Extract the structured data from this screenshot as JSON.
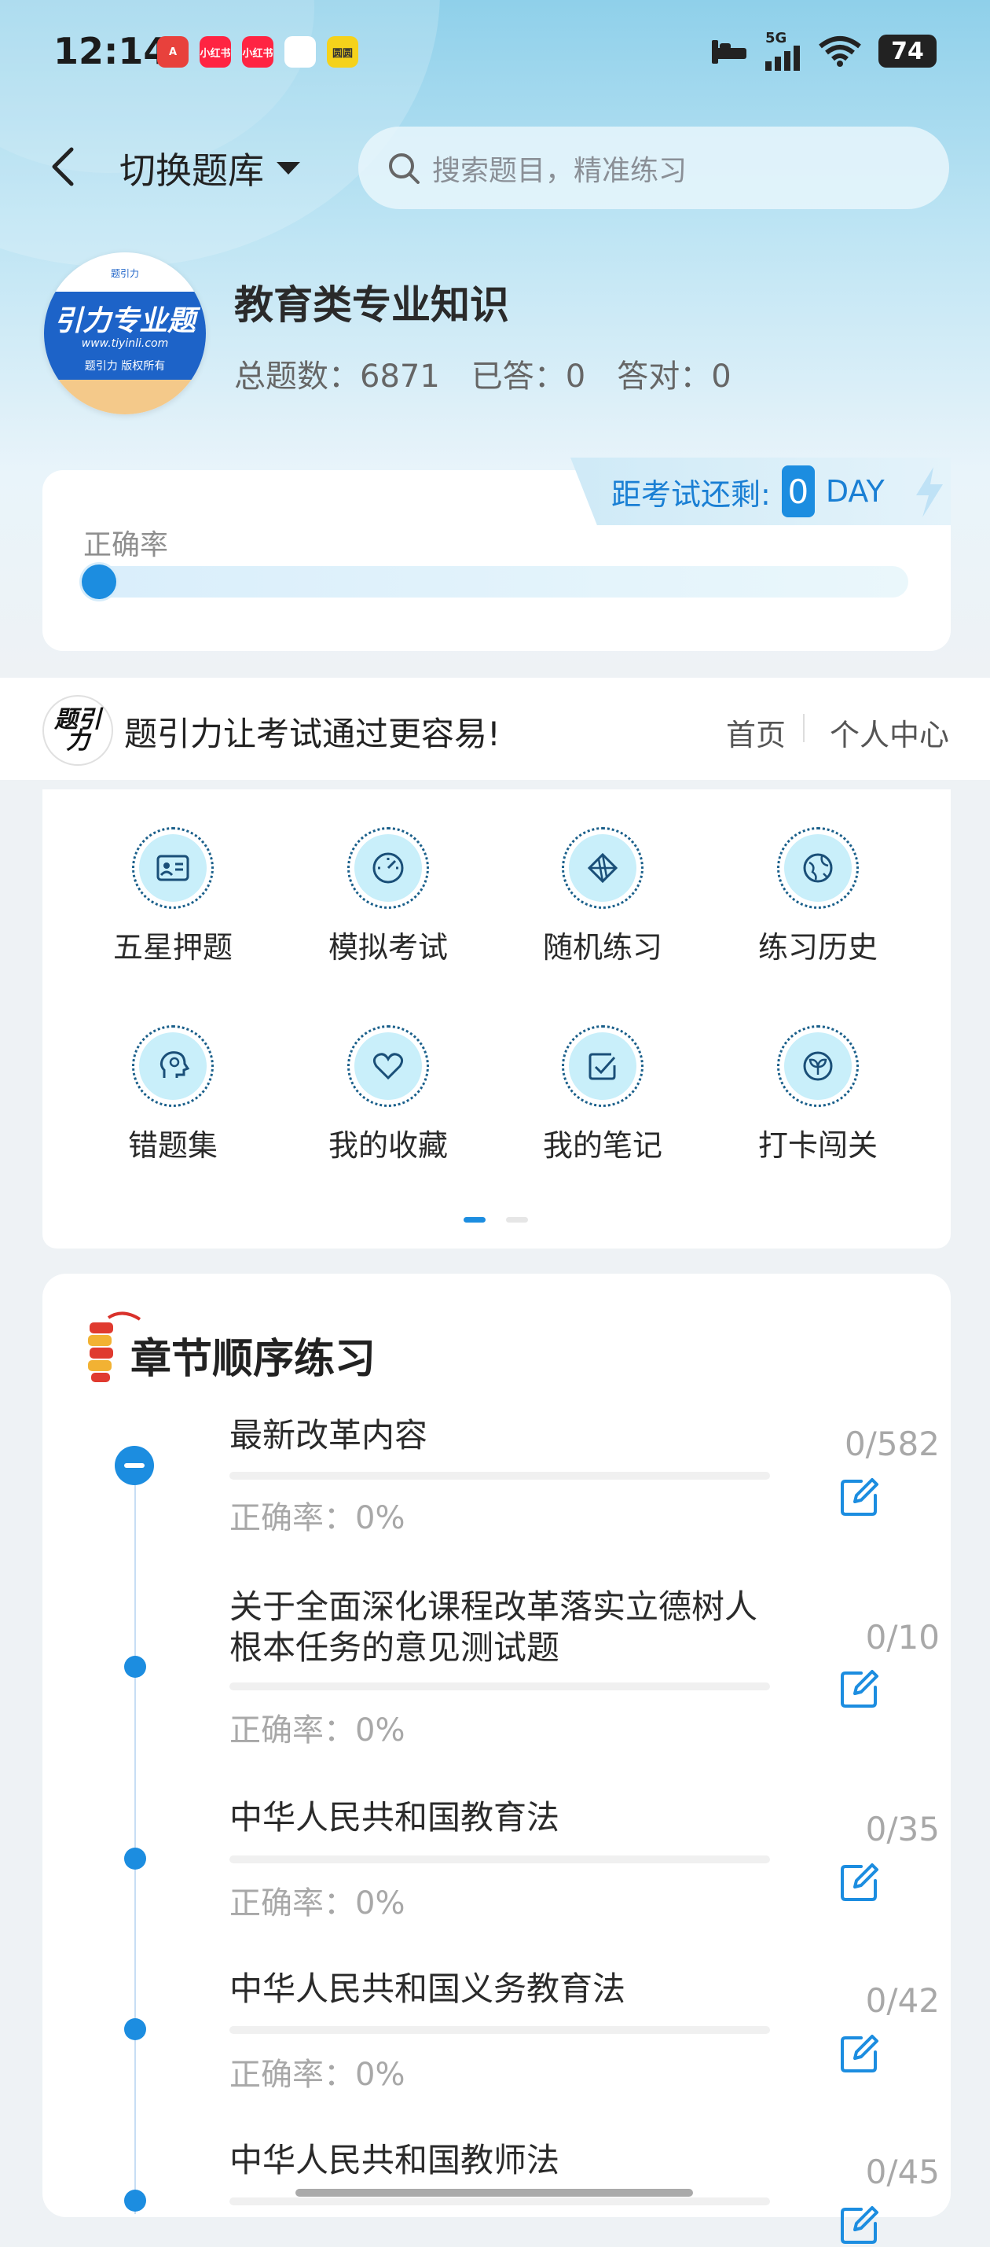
{
  "status_bar": {
    "time": "12:14",
    "app_icons": [
      {
        "name": "app-icon-1",
        "color": "#e8413c",
        "label": "A"
      },
      {
        "name": "xiaohongshu-icon",
        "color": "#ff2442",
        "label": "小红书"
      },
      {
        "name": "xiaohongshu-icon-2",
        "color": "#ff2442",
        "label": "小红书"
      },
      {
        "name": "app-icon-4",
        "color": "#ffffff",
        "label": ""
      },
      {
        "name": "app-icon-5",
        "color": "#f5d21b",
        "label": "圆圆"
      }
    ],
    "network": "5G",
    "battery": "74"
  },
  "header": {
    "switch_label": "切换题库",
    "search_placeholder": "搜索题目，精准练习"
  },
  "bank": {
    "logo_brand": "引力专业题",
    "logo_url": "www.tiyinli.com",
    "logo_rights": "题引力 版权所有",
    "logo_top": "题引力",
    "title": "教育类专业知识",
    "total": "总题数：6871",
    "answered": "已答：0",
    "correct": "答对：0"
  },
  "accuracy_card": {
    "countdown_label": "距考试还剩:",
    "countdown_value": "0",
    "countdown_unit": "DAY",
    "label": "正确率",
    "accuracy_fraction": 0
  },
  "slogan": {
    "logo_text": "题引力",
    "text": "题引力让考试通过更容易!",
    "nav_home": "首页",
    "nav_me": "个人中心"
  },
  "functions": [
    {
      "label": "五星押题",
      "icon": "id-card-icon"
    },
    {
      "label": "模拟考试",
      "icon": "speedometer-icon"
    },
    {
      "label": "随机练习",
      "icon": "shuffle-icon"
    },
    {
      "label": "练习历史",
      "icon": "globe-icon"
    },
    {
      "label": "错题集",
      "icon": "head-icon"
    },
    {
      "label": "我的收藏",
      "icon": "heart-icon"
    },
    {
      "label": "我的笔记",
      "icon": "note-icon"
    },
    {
      "label": "打卡闯关",
      "icon": "sprout-icon"
    }
  ],
  "chapters_section": {
    "title": "章节顺序练习",
    "items": [
      {
        "name": "最新改革内容",
        "accuracy": "正确率：0%",
        "count": "0/582"
      },
      {
        "name": "关于全面深化课程改革落实立德树人根本任务的意见测试题",
        "accuracy": "正确率：0%",
        "count": "0/10"
      },
      {
        "name": "中华人民共和国教育法",
        "accuracy": "正确率：0%",
        "count": "0/35"
      },
      {
        "name": "中华人民共和国义务教育法",
        "accuracy": "正确率：0%",
        "count": "0/42"
      },
      {
        "name": "中华人民共和国教师法",
        "accuracy": "",
        "count": "0/45"
      }
    ]
  }
}
